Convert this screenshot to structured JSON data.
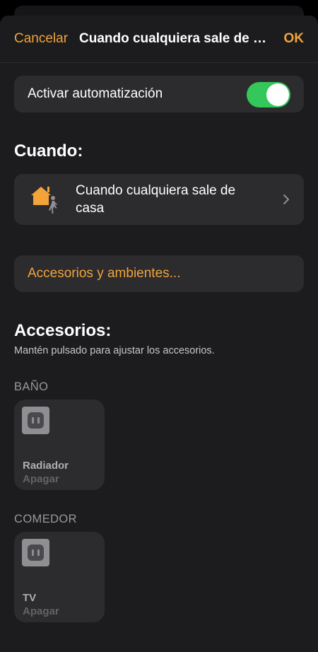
{
  "nav": {
    "cancel_label": "Cancelar",
    "title": "Cuando cualquiera sale de casa",
    "ok_label": "OK"
  },
  "toggle": {
    "label": "Activar automatización",
    "enabled": true,
    "on_color": "#34c759"
  },
  "when": {
    "heading": "Cuando:",
    "trigger": {
      "text": "Cuando cualquiera sale de casa",
      "icon": "house-person-leaving-icon"
    }
  },
  "accessories_button": {
    "label": "Accesorios y ambientes..."
  },
  "accessories": {
    "heading": "Accesorios:",
    "hint": "Mantén pulsado para ajustar los accesorios.",
    "rooms": [
      {
        "name": "BAÑO",
        "tile": {
          "name": "Radiador",
          "state": "Apagar",
          "icon": "outlet-icon"
        }
      },
      {
        "name": "COMEDOR",
        "tile": {
          "name": "TV",
          "state": "Apagar",
          "icon": "outlet-icon"
        }
      }
    ]
  },
  "colors": {
    "accent": "#f2a33a",
    "background": "#1c1c1e",
    "card": "#2c2c2e"
  }
}
